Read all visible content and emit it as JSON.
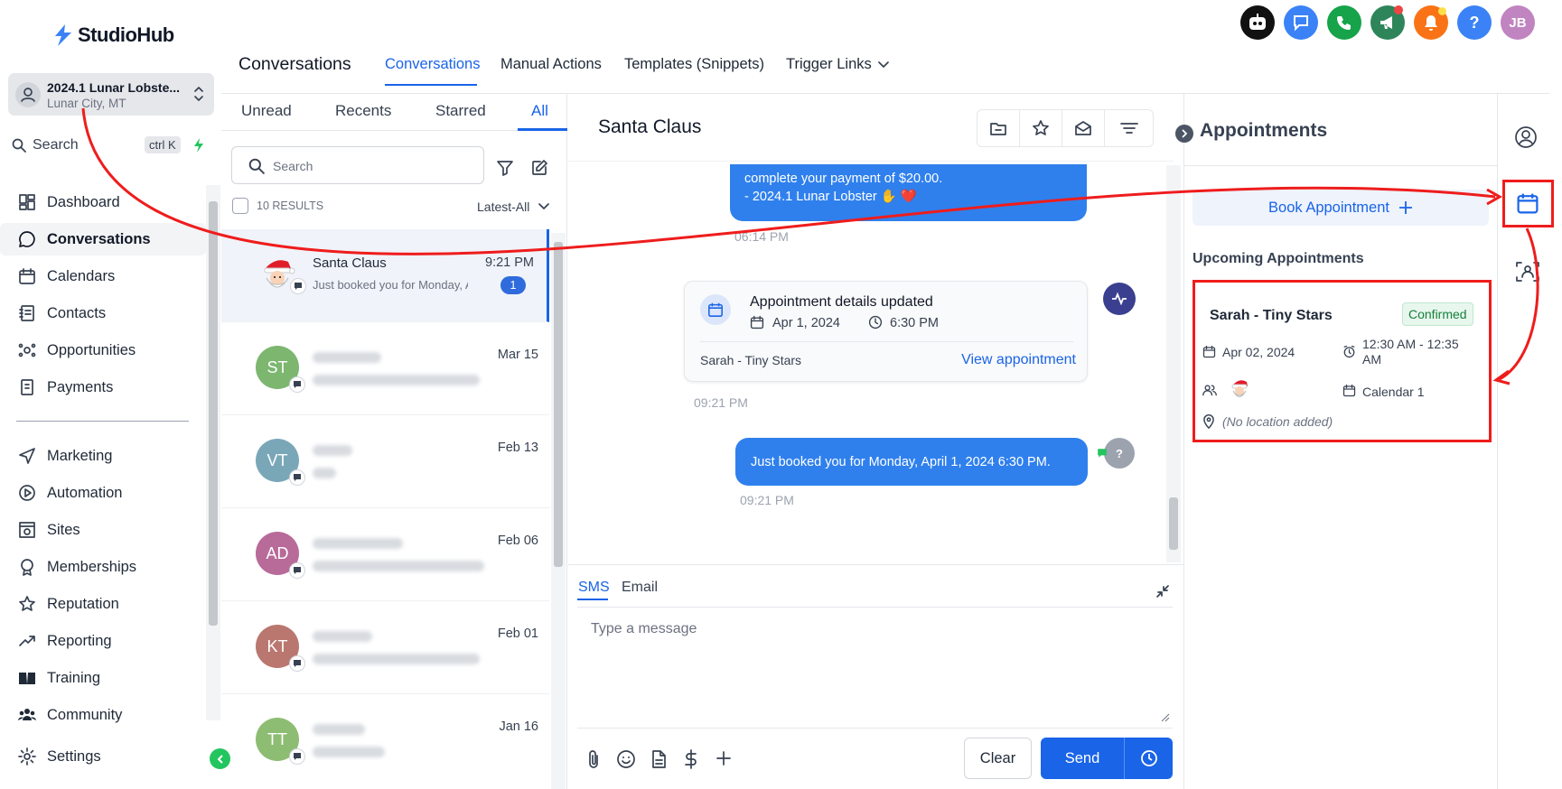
{
  "brand": {
    "name": "StudioHub"
  },
  "location": {
    "name": "2024.1 Lunar Lobste...",
    "city": "Lunar City, MT"
  },
  "search": {
    "label": "Search",
    "shortcut": "ctrl K"
  },
  "nav": {
    "primary": [
      {
        "label": "Dashboard",
        "icon": "dashboard-icon"
      },
      {
        "label": "Conversations",
        "icon": "chat-icon"
      },
      {
        "label": "Calendars",
        "icon": "calendar-icon"
      },
      {
        "label": "Contacts",
        "icon": "contacts-icon"
      },
      {
        "label": "Opportunities",
        "icon": "opportunities-icon"
      },
      {
        "label": "Payments",
        "icon": "payments-icon"
      }
    ],
    "secondary": [
      {
        "label": "Marketing",
        "icon": "send-icon"
      },
      {
        "label": "Automation",
        "icon": "automation-icon"
      },
      {
        "label": "Sites",
        "icon": "sites-icon"
      },
      {
        "label": "Memberships",
        "icon": "membership-icon"
      },
      {
        "label": "Reputation",
        "icon": "star-icon"
      },
      {
        "label": "Reporting",
        "icon": "trend-icon"
      },
      {
        "label": "Training",
        "icon": "book-icon"
      },
      {
        "label": "Community",
        "icon": "community-icon"
      }
    ],
    "settings": "Settings"
  },
  "header": {
    "page_title": "Conversations",
    "tabs": [
      "Conversations",
      "Manual Actions",
      "Templates (Snippets)",
      "Trigger Links"
    ],
    "user_initials": "JB"
  },
  "filters": {
    "tabs": [
      "Unread",
      "Recents",
      "Starred",
      "All"
    ],
    "search_placeholder": "Search",
    "results": "10 RESULTS",
    "sort": "Latest-All"
  },
  "conversations": [
    {
      "name": "Santa Claus",
      "preview": "Just booked you for Monday, Ap",
      "date": "9:21 PM",
      "unread": "1"
    },
    {
      "initials": "ST",
      "date": "Mar 15",
      "color": "#7cb66f"
    },
    {
      "initials": "VT",
      "date": "Feb 13",
      "color": "#7aa7b8"
    },
    {
      "initials": "AD",
      "date": "Feb 06",
      "color": "#b86a99"
    },
    {
      "initials": "KT",
      "date": "Feb 01",
      "color": "#b9776f"
    },
    {
      "initials": "TT",
      "date": "Jan 16",
      "color": "#8dbd72"
    }
  ],
  "chat": {
    "contact": "Santa Claus",
    "msg1_line1": "complete your payment of $20.00.",
    "msg1_line2": "- 2024.1 Lunar Lobster ✋ ❤️",
    "msg1_time": "06:14 PM",
    "card_title": "Appointment details updated",
    "card_date": "Apr 1, 2024",
    "card_time": "6:30 PM",
    "card_name": "Sarah - Tiny Stars",
    "card_link": "View appointment",
    "card_ts": "09:21 PM",
    "msg2": "Just booked you for Monday, April 1, 2024 6:30 PM.",
    "msg2_time": "09:21 PM"
  },
  "composer": {
    "tab_sms": "SMS",
    "tab_email": "Email",
    "placeholder": "Type a message",
    "clear": "Clear",
    "send": "Send"
  },
  "appointments": {
    "title": "Appointments",
    "book": "Book Appointment",
    "upcoming": "Upcoming Appointments",
    "item": {
      "name": "Sarah - Tiny Stars",
      "status": "Confirmed",
      "date": "Apr 02, 2024",
      "time": "12:30 AM - 12:35 AM",
      "calendar": "Calendar 1",
      "location": "(No location added)"
    }
  },
  "colors": {
    "accent": "#1a64e8",
    "bubble": "#2f80ed",
    "annotation": "#ef1c1c"
  }
}
